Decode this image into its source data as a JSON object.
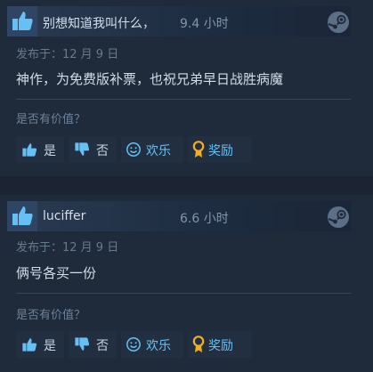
{
  "reviews": [
    {
      "reviewer": "别想知道我叫什么，",
      "hours": "9.4 小时",
      "posted": "发布于：12 月 9 日",
      "text": "神作，为免费版补票，也祝兄弟早日战胜病魔",
      "helpful_prompt": "是否有价值？",
      "votes": {
        "yes": "是",
        "no": "否",
        "funny": "欢乐",
        "award": "奖励"
      }
    },
    {
      "reviewer": "luciffer",
      "hours": "6.6 小时",
      "posted": "发布于：12 月 9 日",
      "text": "俩号各买一份",
      "helpful_prompt": "是否有价值？",
      "votes": {
        "yes": "是",
        "no": "否",
        "funny": "欢乐",
        "award": "奖励"
      }
    }
  ],
  "icons": {
    "recommended": "thumbs-up-icon",
    "steam": "steam-logo-icon",
    "vote_yes": "thumbs-up-icon",
    "vote_no": "thumbs-down-icon",
    "vote_funny": "smiley-icon",
    "vote_award": "award-icon"
  },
  "colors": {
    "page_bg": "#1c2433",
    "card_bg": "#1f2a3b",
    "accent_blue": "#66c0f4",
    "award_gold": "#f2b01e",
    "text_primary": "#d3dde7",
    "text_muted": "#6d8197"
  }
}
